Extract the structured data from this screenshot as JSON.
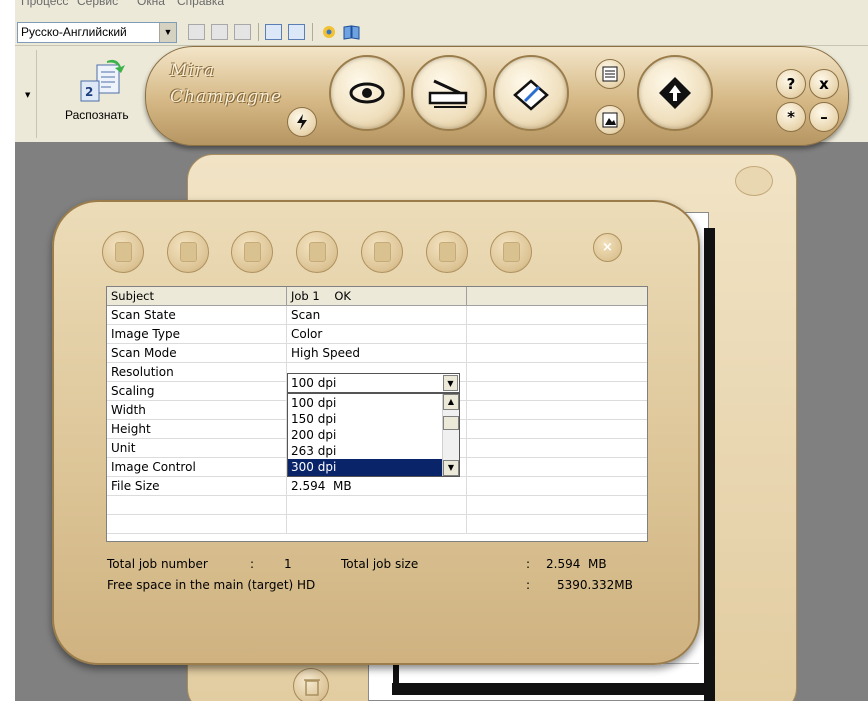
{
  "menubar": {
    "items": [
      "Процесс",
      "Сервис",
      "Окна",
      "Справка"
    ]
  },
  "toolbar": {
    "language": "Русско-Английский"
  },
  "recognize": {
    "label": "Распознать",
    "badge": "2"
  },
  "mira": {
    "brand_line1": "Mira",
    "brand_line2": "Champagne"
  },
  "job": {
    "headers": [
      "Subject",
      "Job 1    OK",
      ""
    ],
    "rows": [
      {
        "subject": "Scan State",
        "value": "Scan"
      },
      {
        "subject": "Image Type",
        "value": "Color"
      },
      {
        "subject": "Scan Mode",
        "value": "High Speed"
      },
      {
        "subject": "Resolution",
        "value": ""
      },
      {
        "subject": "Scaling",
        "value": ""
      },
      {
        "subject": "Width",
        "value": ""
      },
      {
        "subject": "Height",
        "value": ""
      },
      {
        "subject": "Unit",
        "value": ""
      },
      {
        "subject": "Image Control",
        "value": ""
      },
      {
        "subject": "File Size",
        "value": "2.594  MB"
      },
      {
        "subject": "",
        "value": ""
      },
      {
        "subject": "",
        "value": ""
      }
    ],
    "resolution": {
      "selected": "100 dpi",
      "options": [
        "100 dpi",
        "150 dpi",
        "200 dpi",
        "263 dpi",
        "300 dpi"
      ],
      "highlighted": "300 dpi"
    },
    "summary": {
      "total_job_number_label": "Total job number",
      "colon": ":",
      "total_job_number": "1",
      "total_job_size_label": "Total job size",
      "total_job_size": "2.594  MB",
      "free_space_label": "Free space in the main (target) HD",
      "free_space": "5390.332MB"
    }
  },
  "colors": {
    "panel_beige": "#e2cca0",
    "frame_brown": "#9b7d4c",
    "selection_blue": "#0a246a",
    "workspace_gray": "#808080"
  }
}
